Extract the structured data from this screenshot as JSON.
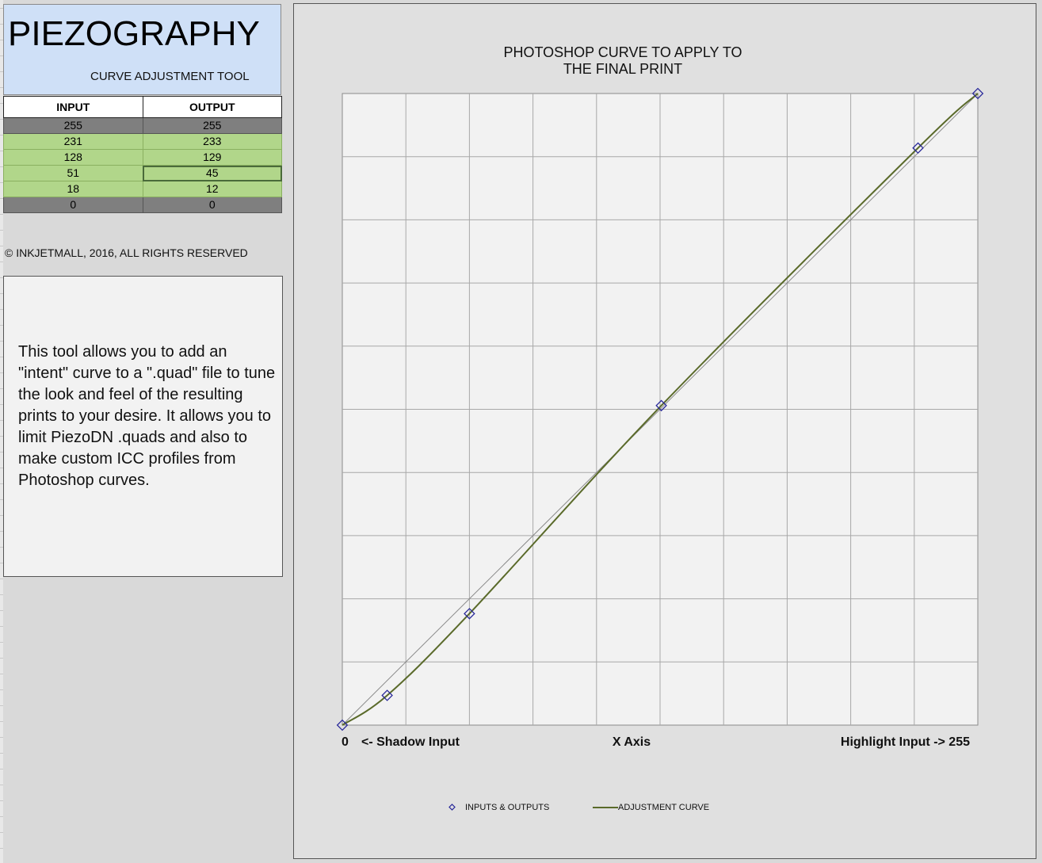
{
  "header": {
    "title": "PIEZOGRAPHY",
    "subtitle": "CURVE ADJUSTMENT TOOL"
  },
  "table": {
    "headers": [
      "INPUT",
      "OUTPUT"
    ],
    "rows": [
      {
        "input": "255",
        "output": "255",
        "style": "gray"
      },
      {
        "input": "231",
        "output": "233",
        "style": "green"
      },
      {
        "input": "128",
        "output": "129",
        "style": "green"
      },
      {
        "input": "51",
        "output": "45",
        "style": "green"
      },
      {
        "input": "18",
        "output": "12",
        "style": "green"
      },
      {
        "input": "0",
        "output": "0",
        "style": "gray"
      }
    ]
  },
  "copyright": "© INKJETMALL, 2016, ALL RIGHTS RESERVED",
  "description": "This tool allows you to add an \"intent\" curve to a \".quad\" file to tune the look and feel of the resulting prints to your desire. It allows you to limit PiezoDN .quads and also to make custom ICC profiles from Photoshop curves.",
  "colors": {
    "header_bg": "#cfe0f7",
    "row_green": "#b1d68a",
    "row_gray": "#7f7f7f",
    "curve": "#5a6a2a",
    "marker": "#2a2a9a"
  },
  "chart_data": {
    "type": "scatter",
    "title_lines": [
      "PHOTOSHOP CURVE TO APPLY TO",
      "THE FINAL PRINT"
    ],
    "xlabel_left": "0",
    "xlabel_shadow": "<- Shadow Input",
    "xlabel_center": "X Axis",
    "xlabel_right": "Highlight Input -> 255",
    "xlim": [
      0,
      255
    ],
    "ylim": [
      0,
      255
    ],
    "grid": true,
    "grid_divisions": 10,
    "legend_position": "bottom",
    "series": [
      {
        "name": "INPUTS & OUTPUTS",
        "kind": "markers",
        "x": [
          0,
          18,
          51,
          128,
          231,
          255
        ],
        "y": [
          0,
          12,
          45,
          129,
          233,
          255
        ]
      },
      {
        "name": "ADJUSTMENT CURVE",
        "kind": "smooth-line",
        "x": [
          0,
          18,
          51,
          128,
          231,
          255
        ],
        "y": [
          0,
          12,
          45,
          129,
          233,
          255
        ]
      }
    ],
    "reference_line": {
      "x": [
        0,
        255
      ],
      "y": [
        0,
        255
      ]
    }
  }
}
